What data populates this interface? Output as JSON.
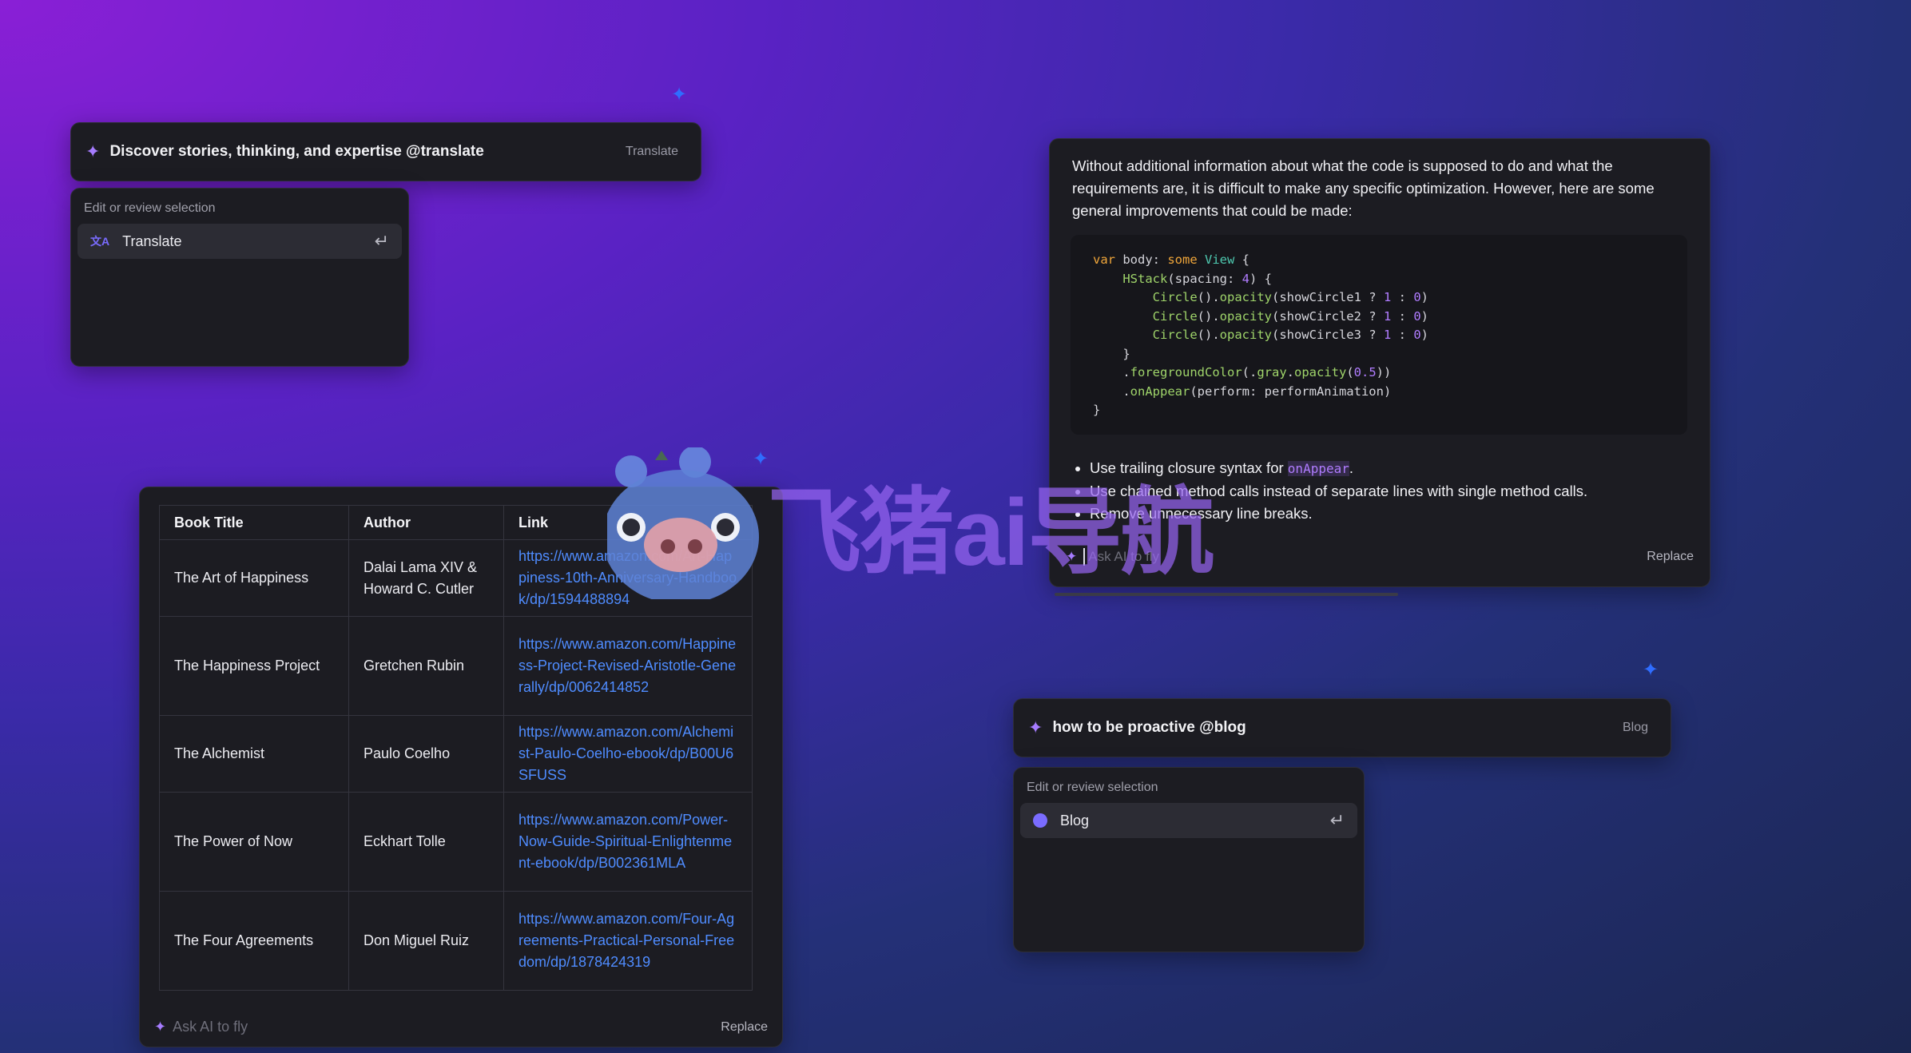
{
  "translate_widget": {
    "prompt": "Discover stories, thinking, and expertise @translate",
    "tag": "Translate",
    "section_title": "Edit or review selection",
    "option_label": "Translate",
    "option_icon": "translate-icon"
  },
  "blog_widget": {
    "prompt": "how to be proactive @blog",
    "tag": "Blog",
    "section_title": "Edit or review selection",
    "option_label": "Blog",
    "option_icon": "blog-icon"
  },
  "books_table": {
    "headers": [
      "Book Title",
      "Author",
      "Link"
    ],
    "rows": [
      {
        "title": "The Art of Happiness",
        "author": "Dalai Lama XIV & Howard C. Cutler",
        "link": "https://www.amazon.com/Art-Happiness-10th-Anniversary-Handbook/dp/1594488894"
      },
      {
        "title": "The Happiness Project",
        "author": "Gretchen Rubin",
        "link": "https://www.amazon.com/Happiness-Project-Revised-Aristotle-Generally/dp/0062414852"
      },
      {
        "title": "The Alchemist",
        "author": "Paulo Coelho",
        "link": "https://www.amazon.com/Alchemist-Paulo-Coelho-ebook/dp/B00U6SFUSS"
      },
      {
        "title": "The Power of Now",
        "author": "Eckhart Tolle",
        "link": "https://www.amazon.com/Power-Now-Guide-Spiritual-Enlightenment-ebook/dp/B002361MLA"
      },
      {
        "title": "The Four Agreements",
        "author": "Don Miguel Ruiz",
        "link": "https://www.amazon.com/Four-Agreements-Practical-Personal-Freedom/dp/1878424319"
      }
    ],
    "ask_placeholder": "Ask AI to fly",
    "replace_label": "Replace"
  },
  "code_answer": {
    "intro": "Without additional information about what the code is supposed to do and what the requirements are, it is difficult to make any specific optimization. However, here are some general improvements that could be made:",
    "tip1_before": "Use trailing closure syntax for ",
    "tip1_code": "onAppear",
    "tip1_after": ".",
    "tip2": "Use chained method calls instead of separate lines with single method calls.",
    "tip3": "Remove unnecessary line breaks.",
    "ask_placeholder": "Ask AI to fly",
    "replace_label": "Replace"
  },
  "watermark": {
    "text": "飞猪ai导航"
  },
  "colors": {
    "accent": "#a67cff",
    "link": "#4f8cff",
    "pin": "#2f6dff"
  }
}
